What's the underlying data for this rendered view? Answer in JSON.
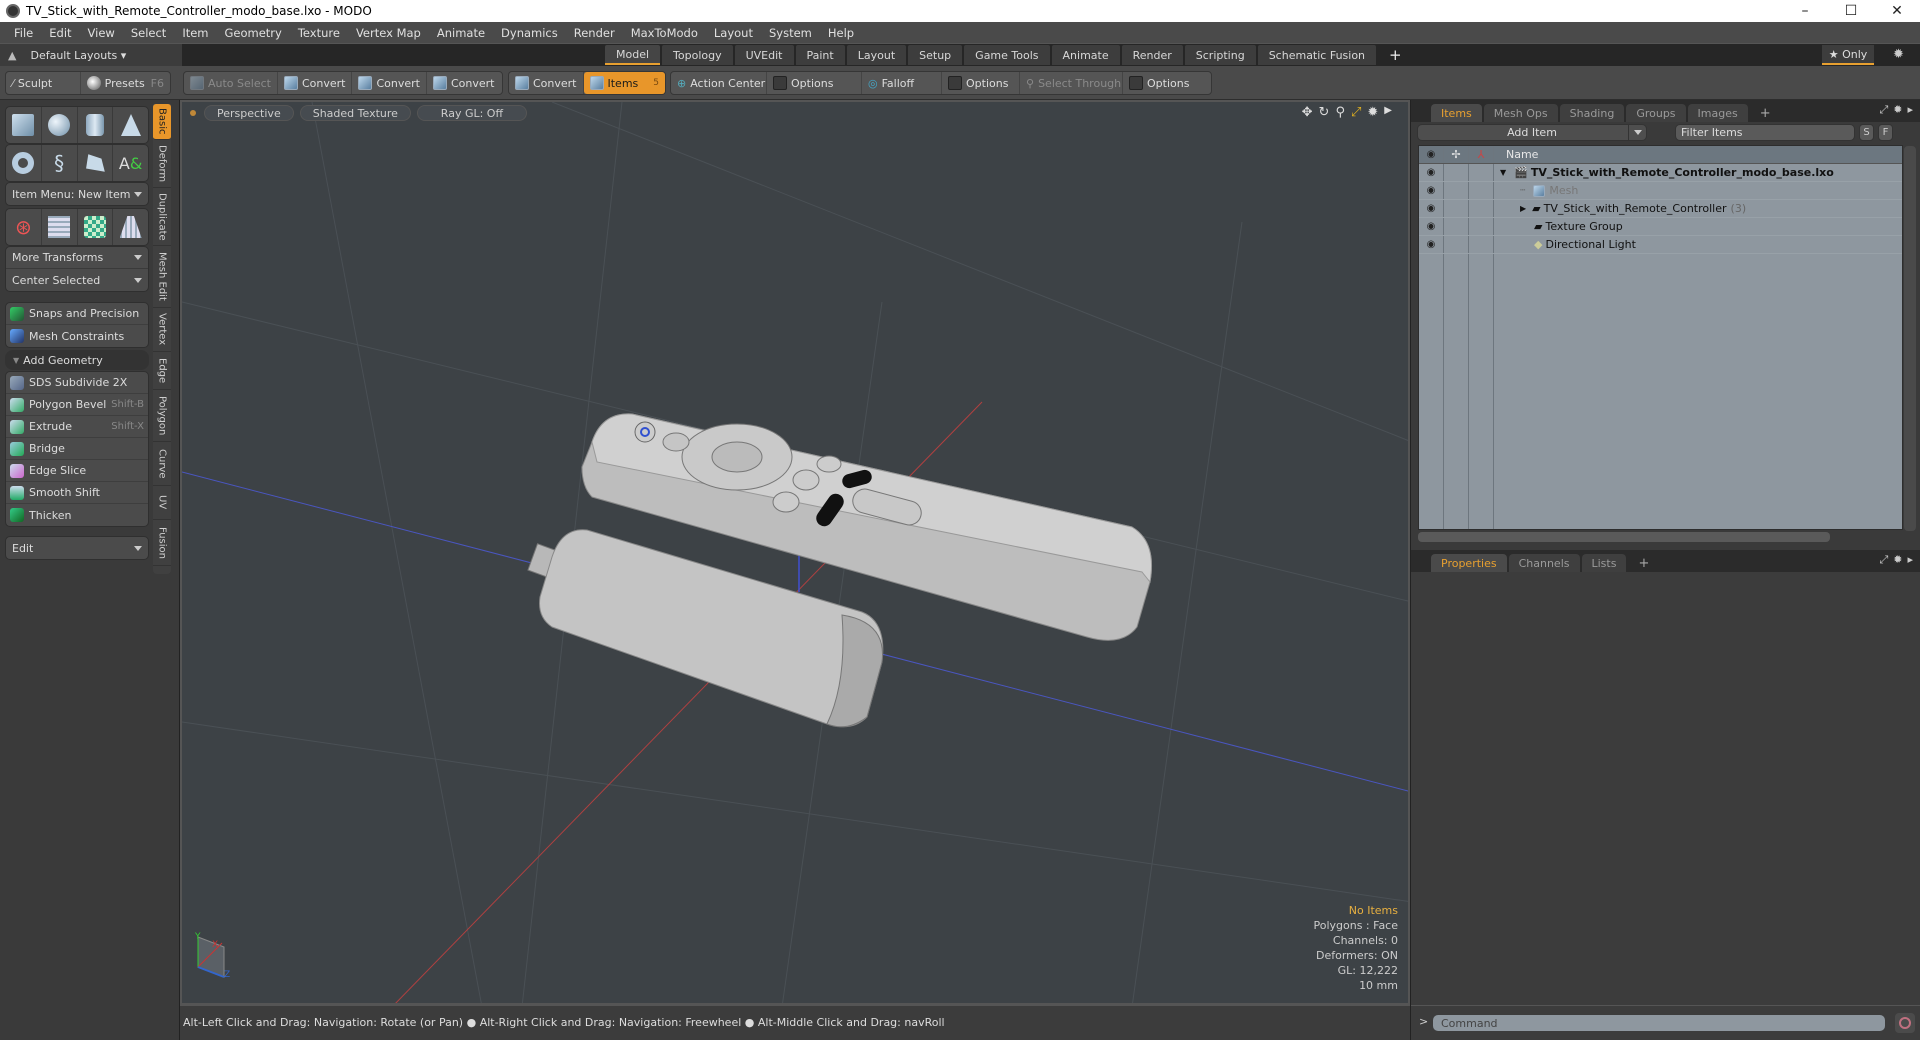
{
  "window": {
    "title": "TV_Stick_with_Remote_Controller_modo_base.lxo - MODO",
    "minimize": "–",
    "maximize": "☐",
    "close": "✕"
  },
  "menu": [
    "File",
    "Edit",
    "View",
    "Select",
    "Item",
    "Geometry",
    "Texture",
    "Vertex Map",
    "Animate",
    "Dynamics",
    "Render",
    "MaxToModo",
    "Layout",
    "System",
    "Help"
  ],
  "layouts": {
    "label": "Default Layouts ▾",
    "tabs": [
      "Model",
      "Topology",
      "UVEdit",
      "Paint",
      "Layout",
      "Setup",
      "Game Tools",
      "Animate",
      "Render",
      "Scripting",
      "Schematic Fusion"
    ],
    "active": "Model",
    "add": "+",
    "only": "★ Only"
  },
  "toolbar": {
    "sculpt": "Sculpt",
    "presets": "Presets",
    "presets_key": "F6",
    "auto_select": "Auto Select",
    "convert": [
      "Convert",
      "Convert",
      "Convert",
      "Convert"
    ],
    "items": "Items",
    "items_count": "5",
    "action_center": "Action Center",
    "options1": "Options",
    "falloff": "Falloff",
    "options2": "Options",
    "select_through": "Select Through",
    "options3": "Options"
  },
  "lefttools": {
    "item_menu": "Item Menu: New Item",
    "more_transforms": "More Transforms",
    "center_selected": "Center Selected",
    "snaps": "Snaps and Precision",
    "mesh_constraints": "Mesh Constraints",
    "add_geometry": "Add Geometry",
    "tools": [
      {
        "label": "SDS Subdivide 2X",
        "shortcut": ""
      },
      {
        "label": "Polygon Bevel",
        "shortcut": "Shift-B"
      },
      {
        "label": "Extrude",
        "shortcut": "Shift-X"
      },
      {
        "label": "Bridge",
        "shortcut": ""
      },
      {
        "label": "Edge Slice",
        "shortcut": ""
      },
      {
        "label": "Smooth Shift",
        "shortcut": ""
      },
      {
        "label": "Thicken",
        "shortcut": ""
      }
    ],
    "edit": "Edit",
    "vtabs": [
      "Basic",
      "Deform",
      "Duplicate",
      "Mesh Edit",
      "Vertex",
      "Edge",
      "Polygon",
      "Curve",
      "UV",
      "Fusion"
    ]
  },
  "viewport": {
    "view": "Perspective",
    "shading": "Shaded Texture",
    "raygl": "Ray GL: Off",
    "hud": {
      "selection": "No Items",
      "polygons": "Polygons : Face",
      "channels": "Channels: 0",
      "deformers": "Deformers: ON",
      "gl": "GL: 12,222",
      "unit": "10 mm"
    },
    "axis": {
      "x": "X",
      "y": "Y",
      "z": "Z"
    }
  },
  "status": "Alt-Left Click and Drag: Navigation: Rotate (or Pan) ● Alt-Right Click and Drag: Navigation: Freewheel ● Alt-Middle Click and Drag: navRoll",
  "rightpanel": {
    "tabs": [
      "Items",
      "Mesh Ops",
      "Shading",
      "Groups",
      "Images"
    ],
    "add_item": "Add Item",
    "filter_placeholder": "Filter Items",
    "s": "S",
    "f": "F",
    "col_name": "Name",
    "items": [
      {
        "name": "TV_Stick_with_Remote_Controller_modo_base.lxo",
        "type": "scene",
        "count": ""
      },
      {
        "name": "Mesh",
        "type": "mesh",
        "count": ""
      },
      {
        "name": "TV_Stick_with_Remote_Controller",
        "type": "group",
        "count": "(3)"
      },
      {
        "name": "Texture Group",
        "type": "group",
        "count": ""
      },
      {
        "name": "Directional Light",
        "type": "light",
        "count": ""
      }
    ],
    "bottom_tabs": [
      "Properties",
      "Channels",
      "Lists"
    ],
    "command_placeholder": "Command",
    "prompt": ">"
  }
}
